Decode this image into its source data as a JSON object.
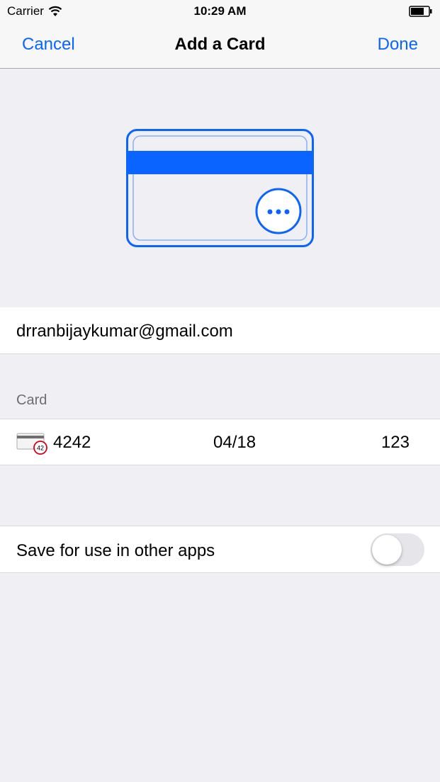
{
  "status_bar": {
    "carrier": "Carrier",
    "time": "10:29 AM",
    "wifi_icon": "wifi-icon",
    "battery_icon": "battery-icon"
  },
  "nav": {
    "cancel_label": "Cancel",
    "title": "Add a Card",
    "done_label": "Done"
  },
  "illustration": {
    "icon": "credit-card-back-icon",
    "accent_color": "#0a64ff"
  },
  "email": {
    "value": "drranbijaykumar@gmail.com"
  },
  "card_section": {
    "header": "Card",
    "brand_icon": "card-error-icon",
    "brand_icon_text": "42",
    "number": "4242",
    "expiry": "04/18",
    "cvc": "123"
  },
  "save": {
    "label": "Save for use in other apps",
    "toggle_on": false
  },
  "colors": {
    "tint": "#0a64ff",
    "background": "#efeff4",
    "error": "#d0021b"
  }
}
